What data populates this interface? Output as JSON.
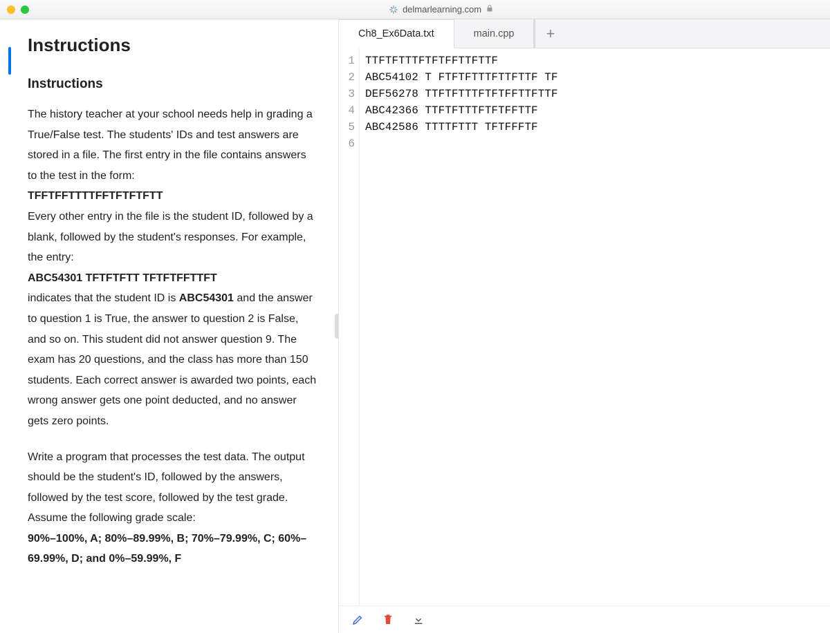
{
  "chrome": {
    "domain": "delmarlearning.com"
  },
  "left": {
    "title": "Instructions",
    "subtitle": "Instructions",
    "para1_a": "The history teacher at your school needs help in grading a True/False test. The students' IDs and test answers are stored in a file. The first entry in the file contains answers to the test in the form:",
    "answer_key": "TFFTFFTTTTFFTFTFTFTT",
    "para1_b": "Every other entry in the file is the student ID, followed by a blank, followed by the student's responses. For example, the entry:",
    "sample_entry": "ABC54301 TFTFTFTT TFTFTFFTTFT",
    "para1_c_pre": "indicates that the student ID is ",
    "sample_id": "ABC54301",
    "para1_c_post": " and the answer to question 1 is True, the answer to question 2 is False, and so on. This student did not answer question 9. The exam has 20 questions, and the class has more than 150 students. Each correct answer is awarded two points, each wrong answer gets one point deducted, and no answer gets zero points.",
    "para2": "Write a program that processes the test data. The output should be the student's ID, followed by the answers, followed by the test score, followed by the test grade. Assume the following grade scale:",
    "grade_scale": "90%–100%, A; 80%–89.99%, B; 70%–79.99%, C; 60%–69.99%, D; and 0%–59.99%, F"
  },
  "tabs": {
    "active": "Ch8_Ex6Data.txt",
    "inactive": "main.cpp"
  },
  "file": {
    "lines": [
      "TTFTFTTTFTFTFFTTFTTF",
      "ABC54102 T FTFTFTTTFTTFTTF TF",
      "DEF56278 TTFTFTTTFTFTFFTTFTTF",
      "ABC42366 TTFTFTTTFTFTFFTTF",
      "ABC42586 TTTTFTTT TFTFFFTF",
      ""
    ]
  },
  "tools": {
    "edit": "edit-icon",
    "delete": "trash-icon",
    "download": "download-icon"
  }
}
